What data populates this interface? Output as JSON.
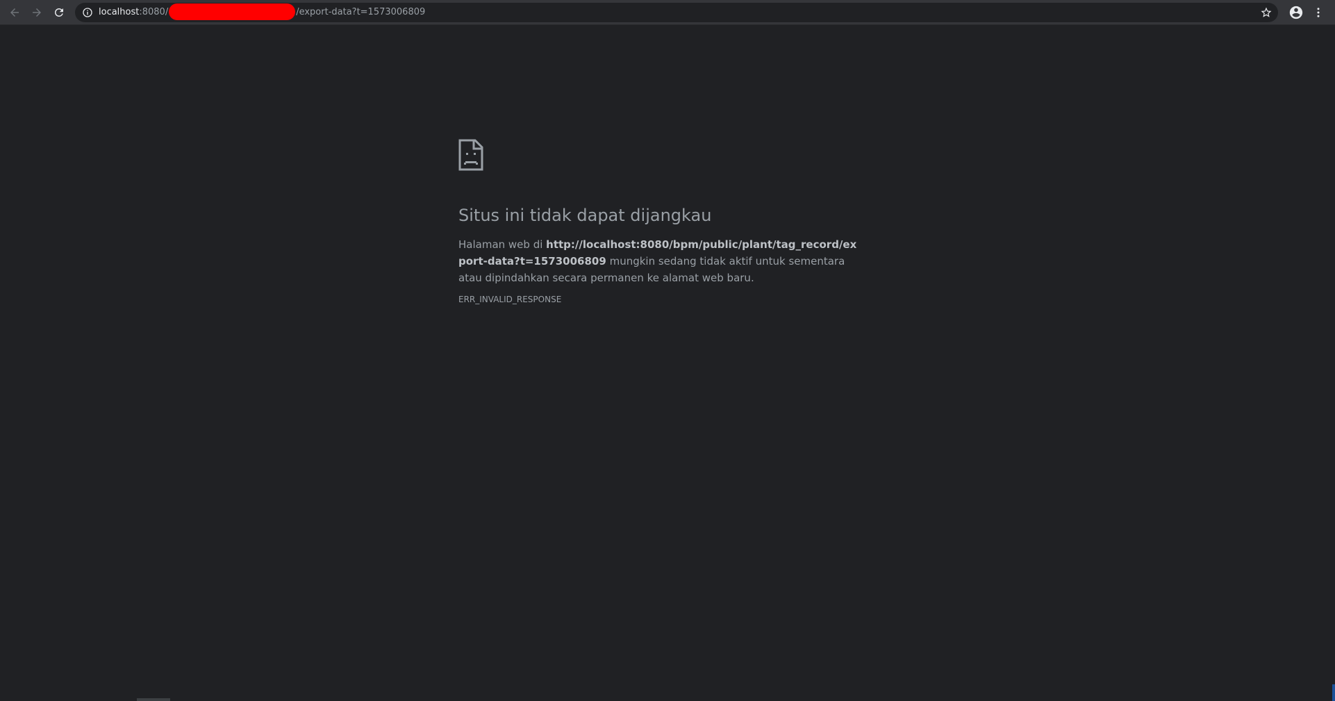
{
  "browser": {
    "url_host": "localhost",
    "url_port_and_path_start": ":8080/",
    "url_path_end": "/export-data?t=1573006809",
    "icons": {
      "back": "arrow-back-icon",
      "forward": "arrow-forward-icon",
      "reload": "reload-icon",
      "info": "info-icon",
      "bookmark": "star-icon",
      "profile": "account-circle-icon",
      "menu": "three-dots-vertical-icon"
    }
  },
  "error_page": {
    "icon": "sad-document-icon",
    "title": "Situs ini tidak dapat dijangkau",
    "desc_prefix": "Halaman web di ",
    "desc_url": "http://localhost:8080/bpm/public/plant/tag_record/export-data?t=1573006809",
    "desc_suffix": " mungkin sedang tidak aktif untuk sementara atau dipindahkan secara permanen ke alamat web baru.",
    "error_code": "ERR_INVALID_RESPONSE"
  },
  "colors": {
    "background": "#202124",
    "toolbar": "#35363a",
    "text": "#9aa0a6",
    "redaction": "#ff0000"
  }
}
